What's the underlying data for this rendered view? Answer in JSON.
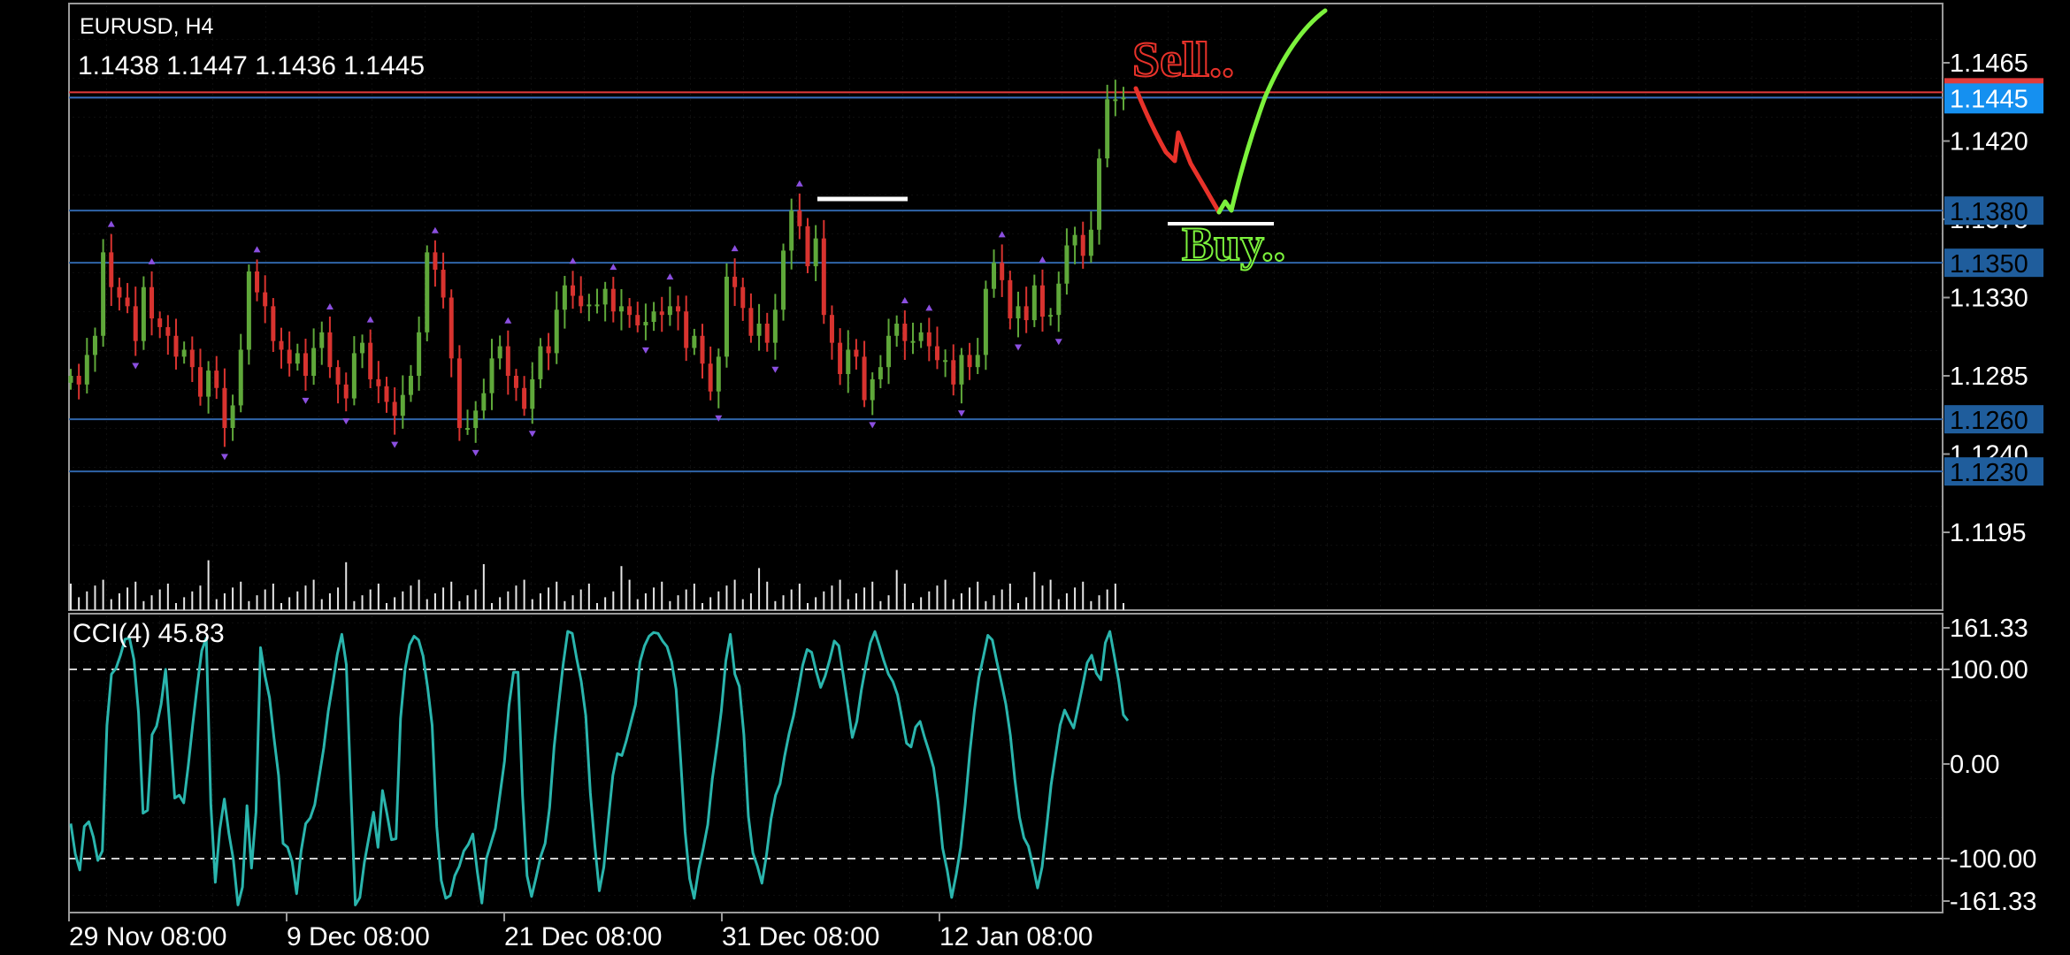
{
  "header": {
    "symbol_timeframe": "EURUSD, H4",
    "ohlc": "1.1438 1.1447 1.1436 1.1445"
  },
  "indicator": {
    "label": "CCI(4) 45.83"
  },
  "annotations": {
    "sell_text": "Sell..",
    "buy_text": "Buy..",
    "sell_color": "#e8322a",
    "buy_color": "#7cf23c"
  },
  "colors": {
    "background": "#000000",
    "bull_candle": "#5fa83a",
    "bear_candle": "#d8332f",
    "level_line": "#2f64a8",
    "level_tag": "#1f5d9c",
    "current_price_tag": "#1590f0",
    "current_price_line": "#e23b3b",
    "cci_line": "#2ab5ad",
    "fractal_marker": "#8b4fe0"
  },
  "chart_data": [
    {
      "type": "candlestick",
      "title": "",
      "symbol": "EURUSD",
      "timeframe": "H4",
      "y_ticks": [
        "1.1465",
        "1.1420",
        "1.1375",
        "1.1330",
        "1.1285",
        "1.1240",
        "1.1195"
      ],
      "ylim": [
        1.1175,
        1.1485
      ],
      "x_ticks": [
        "29 Nov 08:00",
        "9 Dec 08:00",
        "21 Dec 08:00",
        "31 Dec 08:00",
        "12 Jan 08:00"
      ],
      "current_price": "1.1445",
      "horizontal_levels": [
        "1.1380",
        "1.1350",
        "1.1260",
        "1.1230"
      ],
      "close": [
        1.1285,
        1.128,
        1.1297,
        1.1308,
        1.1356,
        1.1336,
        1.133,
        1.1325,
        1.1305,
        1.1336,
        1.1318,
        1.1313,
        1.1308,
        1.1296,
        1.13,
        1.129,
        1.1273,
        1.1288,
        1.1278,
        1.1255,
        1.1268,
        1.13,
        1.1345,
        1.1333,
        1.1325,
        1.1305,
        1.13,
        1.1292,
        1.1298,
        1.1285,
        1.1301,
        1.131,
        1.129,
        1.128,
        1.1272,
        1.1298,
        1.1304,
        1.1283,
        1.1279,
        1.127,
        1.1262,
        1.1274,
        1.1285,
        1.131,
        1.1356,
        1.1346,
        1.133,
        1.1295,
        1.1255,
        1.1255,
        1.1265,
        1.1275,
        1.1295,
        1.1302,
        1.1285,
        1.1278,
        1.1266,
        1.1283,
        1.1302,
        1.1298,
        1.1323,
        1.1337,
        1.1331,
        1.1325,
        1.1326,
        1.1326,
        1.1335,
        1.1322,
        1.1325,
        1.132,
        1.1314,
        1.1316,
        1.1322,
        1.132,
        1.1325,
        1.1322,
        1.1301,
        1.1308,
        1.1292,
        1.1276,
        1.1296,
        1.1342,
        1.1336,
        1.1324,
        1.1308,
        1.1315,
        1.1304,
        1.1323,
        1.1357,
        1.138,
        1.1371,
        1.1348,
        1.1364,
        1.132,
        1.1304,
        1.1286,
        1.13,
        1.1296,
        1.1271,
        1.1283,
        1.129,
        1.1308,
        1.1315,
        1.1305,
        1.1305,
        1.131,
        1.1302,
        1.1294,
        1.1294,
        1.128,
        1.1297,
        1.129,
        1.1297,
        1.1335,
        1.135,
        1.134,
        1.1318,
        1.1325,
        1.1317,
        1.1337,
        1.1319,
        1.132,
        1.1338,
        1.136,
        1.1366,
        1.1354,
        1.1369,
        1.141,
        1.1444,
        1.1444,
        1.1445
      ],
      "x_range": [
        "27 Nov",
        "14 Jan"
      ]
    },
    {
      "type": "line",
      "title": "",
      "name": "CCI(4)",
      "last_value": "45.83",
      "y_ticks": [
        "161.33",
        "100.00",
        "0.00",
        "-100.00",
        "-161.33"
      ],
      "ylim": [
        -161.33,
        161.33
      ],
      "levels": [
        100,
        -100
      ],
      "values": [
        -63,
        -95,
        -112,
        -66,
        -61,
        -77,
        -102,
        -92,
        41,
        95,
        101,
        115,
        132,
        133,
        110,
        54,
        -52,
        -49,
        31,
        40,
        63,
        100,
        33,
        -36,
        -33,
        -41,
        -2,
        42,
        83,
        120,
        133,
        -42,
        -125,
        -69,
        -37,
        -73,
        -101,
        -149,
        -130,
        -44,
        -110,
        -51,
        123,
        93,
        70,
        27,
        -12,
        -84,
        -88,
        -103,
        -137,
        -92,
        -63,
        -57,
        -43,
        -13,
        17,
        56,
        85,
        116,
        137,
        105,
        -27,
        -149,
        -141,
        -104,
        -77,
        -51,
        -88,
        -28,
        -53,
        -80,
        -79,
        48,
        100,
        126,
        135,
        131,
        114,
        81,
        41,
        -66,
        -123,
        -142,
        -139,
        -118,
        -108,
        -92,
        -85,
        -74,
        -114,
        -147,
        -100,
        -84,
        -68,
        -33,
        3,
        62,
        97,
        97,
        -33,
        -118,
        -140,
        -120,
        -98,
        -84,
        -46,
        18,
        63,
        105,
        141,
        138,
        111,
        87,
        51,
        -30,
        -86,
        -134,
        -109,
        -59,
        -12,
        11,
        9,
        25,
        44,
        63,
        108,
        125,
        135,
        139,
        138,
        130,
        124,
        108,
        79,
        5,
        -72,
        -121,
        -142,
        -111,
        -89,
        -64,
        -16,
        18,
        56,
        109,
        137,
        95,
        82,
        31,
        -55,
        -94,
        -108,
        -126,
        -96,
        -58,
        -33,
        -21,
        8,
        32,
        51,
        77,
        104,
        121,
        118,
        98,
        81,
        93,
        110,
        130,
        125,
        94,
        62,
        28,
        45,
        78,
        104,
        128,
        140,
        125,
        109,
        95,
        87,
        73,
        48,
        22,
        18,
        39,
        45,
        28,
        13,
        -4,
        -40,
        -89,
        -112,
        -141,
        -117,
        -88,
        -42,
        12,
        56,
        91,
        113,
        136,
        131,
        108,
        86,
        63,
        30,
        -17,
        -56,
        -78,
        -87,
        -108,
        -131,
        -109,
        -67,
        -22,
        10,
        41,
        57,
        47,
        38,
        60,
        83,
        107,
        115,
        96,
        89,
        128,
        140,
        114,
        87,
        52,
        45.83
      ],
      "x_range": [
        "27 Nov",
        "14 Jan"
      ]
    }
  ]
}
